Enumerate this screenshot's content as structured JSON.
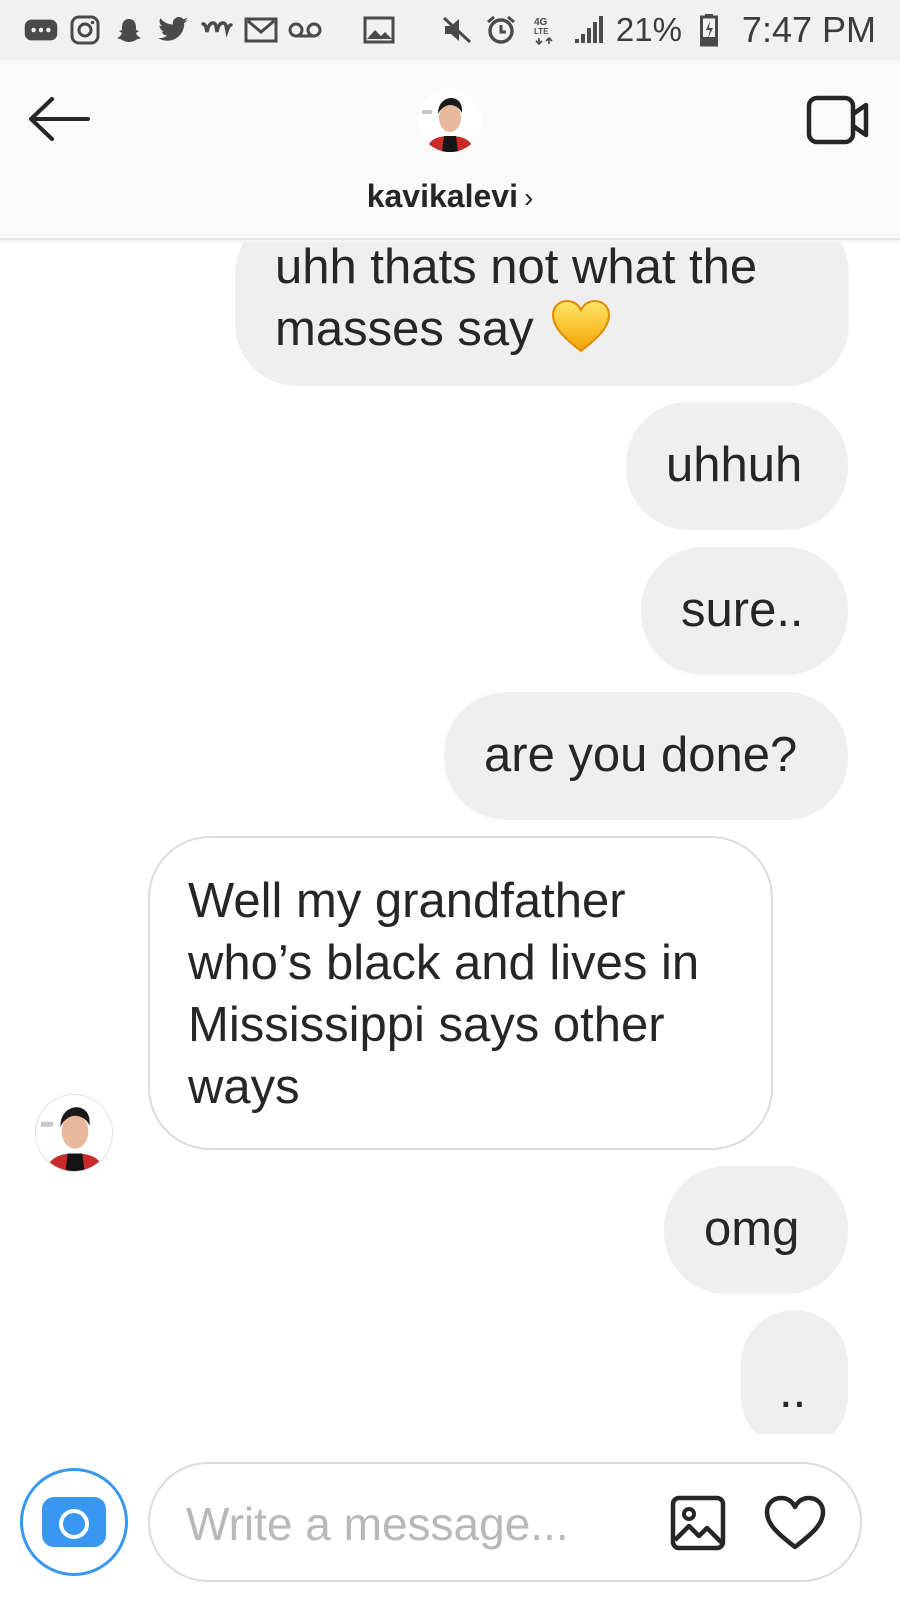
{
  "status_bar": {
    "battery_percent": "21%",
    "time": "7:47 PM",
    "network": "4G LTE",
    "left_icons": [
      "more-notifications-icon",
      "instagram-icon",
      "snapchat-icon",
      "twitter-icon",
      "wattpad-icon",
      "gmail-icon",
      "voicemail-icon"
    ],
    "right_icons": [
      "gallery-icon",
      "mute-icon",
      "alarm-icon",
      "network-4g-lte-icon",
      "signal-icon",
      "battery-icon"
    ]
  },
  "header": {
    "username": "kavikalevi",
    "chevron": "›",
    "back_icon": "back-arrow-icon",
    "video_icon": "video-call-icon"
  },
  "messages": [
    {
      "sender": "me",
      "text": "uhh thats not what the masses say",
      "emoji": "💛"
    },
    {
      "sender": "me",
      "text": "uhhuh"
    },
    {
      "sender": "me",
      "text": "sure.."
    },
    {
      "sender": "me",
      "text": "are you done?"
    },
    {
      "sender": "kavikalevi",
      "text": "Well my grandfather who’s black and lives in Mississippi says other ways"
    },
    {
      "sender": "me",
      "text": "omg"
    },
    {
      "sender": "me",
      "text": ".."
    }
  ],
  "composer": {
    "placeholder": "Write a message...",
    "value": "",
    "camera_icon": "camera-icon",
    "gallery_icon": "image-gallery-icon",
    "like_icon": "heart-icon"
  },
  "colors": {
    "outgoing_bubble": "#efefef",
    "incoming_border": "#dbdbdb",
    "accent": "#3897f0",
    "text": "#262626"
  }
}
